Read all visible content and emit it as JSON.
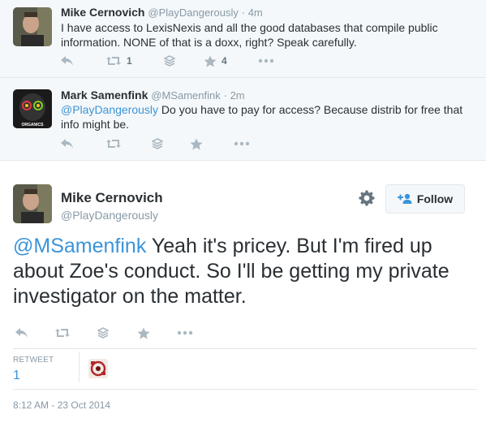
{
  "tweets": [
    {
      "name": "Mike Cernovich",
      "handle": "@PlayDangerously",
      "time": "4m",
      "text": "I have access to LexisNexis and all the good databases that compile public information. NONE of that is a doxx, right? Speak carefully.",
      "retweets": "1",
      "favorites": "4"
    },
    {
      "name": "Mark Samenfink",
      "handle": "@MSamenfink",
      "time": "2m",
      "mention": "@PlayDangerously",
      "text": " Do you have to pay for access? Because distrib for free that info might be.",
      "avatar_text": "ORGANICS"
    }
  ],
  "main": {
    "name": "Mike Cernovich",
    "handle": "@PlayDangerously",
    "follow_label": "Follow",
    "mention": "@MSamenfink",
    "text": " Yeah it's pricey. But I'm fired up about Zoe's conduct. So I'll be getting my private investigator on the matter.",
    "retweet_label": "RETWEET",
    "retweet_count": "1",
    "timestamp": "8:12 AM - 23 Oct 2014"
  },
  "colors": {
    "link": "#3b94d9",
    "action_icon": "#aab8c2",
    "secondary_text": "#8899a6"
  },
  "icons": [
    "reply-icon",
    "retweet-icon",
    "stack-icon",
    "favorite-star-icon",
    "more-dots-icon",
    "gear-icon",
    "add-user-icon"
  ]
}
